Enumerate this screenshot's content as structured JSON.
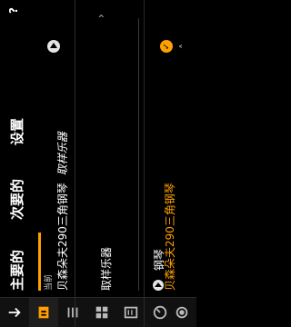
{
  "tabs": [
    {
      "label": "主要的",
      "active": true
    },
    {
      "label": "次要的",
      "active": false
    },
    {
      "label": "设置",
      "active": false
    }
  ],
  "help": "?",
  "current": {
    "label": "当前",
    "value": "贝森朵夫290三角钢琴",
    "instrument_suffix": "取样乐器"
  },
  "selector": {
    "left_label": "取样乐器",
    "right_value": "贝森朵夫290三角钢琴"
  },
  "category": {
    "label": "钢琴"
  },
  "colors": {
    "accent": "#ff9f00",
    "background": "#000000"
  },
  "toolbar": {
    "items": [
      {
        "name": "back-arrow-icon",
        "active": false
      },
      {
        "name": "instrument-icon",
        "active": true
      },
      {
        "name": "list-icon",
        "active": false
      },
      {
        "name": "grid-icon",
        "active": false
      },
      {
        "name": "book-icon",
        "active": false
      },
      {
        "name": "dial-icon",
        "active": false
      },
      {
        "name": "gear-icon",
        "active": false
      }
    ]
  }
}
